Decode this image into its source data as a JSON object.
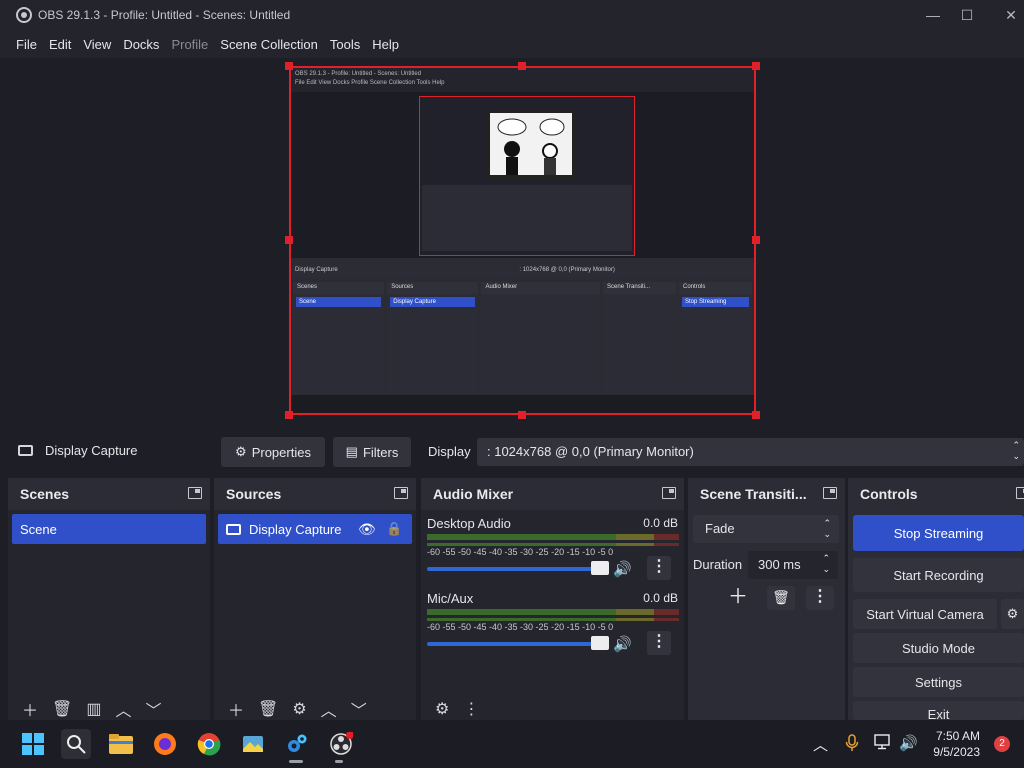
{
  "window": {
    "title": "OBS 29.1.3 - Profile: Untitled - Scenes: Untitled",
    "minimize": "—",
    "maximize": "☐",
    "close": "✕"
  },
  "menu": {
    "file": "File",
    "edit": "Edit",
    "view": "View",
    "docks": "Docks",
    "profile": "Profile",
    "scene_collection": "Scene Collection",
    "tools": "Tools",
    "help": "Help"
  },
  "preview": {
    "nested_title": "OBS 29.1.3 - Profile: Untitled - Scenes: Untitled",
    "nested_menu": "File  Edit  View  Docks  Profile  Scene Collection  Tools  Help",
    "nested_source": "Display Capture",
    "nested_display": ": 1024x768 @ 0,0 (Primary Monitor)",
    "nested_scenes": "Scenes",
    "nested_scene": "Scene",
    "nested_sources": "Sources",
    "nested_audio": "Audio Mixer",
    "nested_transitions": "Scene Transiti...",
    "nested_controls": "Controls",
    "nested_stop": "Stop Streaming"
  },
  "source_bar": {
    "source_name": "Display Capture",
    "properties_label": "Properties",
    "filters_label": "Filters",
    "display_label": "Display",
    "display_value": ": 1024x768 @ 0,0 (Primary Monitor)"
  },
  "scenes": {
    "title": "Scenes",
    "items": [
      "Scene"
    ]
  },
  "sources": {
    "title": "Sources",
    "items": [
      "Display Capture"
    ]
  },
  "audio_mixer": {
    "title": "Audio Mixer",
    "scale": "-60 -55 -50 -45 -40 -35 -30 -25 -20 -15 -10 -5 0",
    "channels": [
      {
        "name": "Desktop Audio",
        "db": "0.0 dB",
        "volume": 0.95
      },
      {
        "name": "Mic/Aux",
        "db": "0.0 dB",
        "volume": 0.95
      }
    ]
  },
  "transitions": {
    "title": "Scene Transiti...",
    "type": "Fade",
    "duration_label": "Duration",
    "duration_value": "300 ms"
  },
  "controls": {
    "title": "Controls",
    "stop_streaming": "Stop Streaming",
    "start_recording": "Start Recording",
    "start_virtual_camera": "Start Virtual Camera",
    "studio_mode": "Studio Mode",
    "settings": "Settings",
    "exit": "Exit"
  },
  "taskbar": {
    "time": "7:50 AM",
    "date": "9/5/2023",
    "notifications": "2"
  },
  "colors": {
    "accent": "#2f50c8",
    "selection_border": "#e0202a",
    "background": "#1e1f26",
    "dock": "#2b2c35"
  }
}
